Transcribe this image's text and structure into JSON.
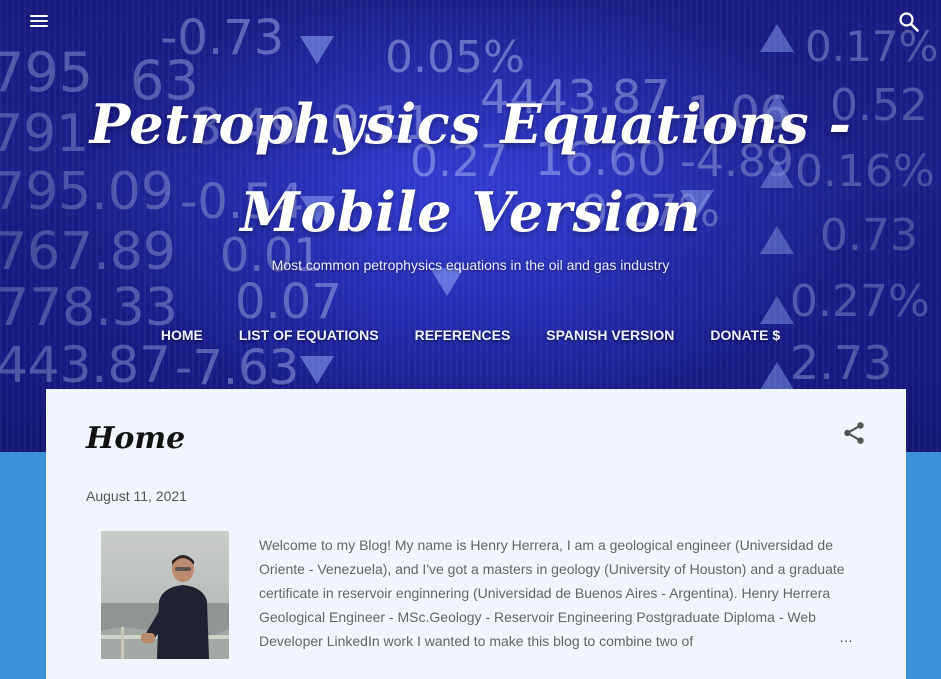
{
  "header": {
    "title": "Petrophysics Equations - Mobile Version",
    "description": "Most common petrophysics equations in the oil and gas industry",
    "menu_icon": "hamburger-menu-icon",
    "search_icon": "search-icon"
  },
  "background_ticker": {
    "numbers": [
      {
        "text": "-0.73"
      },
      {
        "text": "0.05%"
      },
      {
        "text": "0.17%"
      },
      {
        "text": "795"
      },
      {
        "text": "63"
      },
      {
        "text": "8.49"
      },
      {
        "text": "4443.87"
      },
      {
        "text": "-1.06"
      },
      {
        "text": "0.52"
      },
      {
        "text": "791"
      },
      {
        "text": "0.11"
      },
      {
        "text": "16.60"
      },
      {
        "text": "-4.89"
      },
      {
        "text": "0.27"
      },
      {
        "text": "795.09"
      },
      {
        "text": "-0.54"
      },
      {
        "text": "0.27%"
      },
      {
        "text": "0.16%"
      },
      {
        "text": "767.89"
      },
      {
        "text": "0.01"
      },
      {
        "text": "0.73"
      },
      {
        "text": "778.33"
      },
      {
        "text": "0.07"
      },
      {
        "text": "0.27%"
      },
      {
        "text": "443.87"
      },
      {
        "text": "-7.63"
      },
      {
        "text": "2.73"
      }
    ]
  },
  "nav": {
    "items": [
      {
        "label": "HOME"
      },
      {
        "label": "LIST OF EQUATIONS"
      },
      {
        "label": "REFERENCES"
      },
      {
        "label": "SPANISH VERSION"
      },
      {
        "label": "DONATE $"
      }
    ]
  },
  "post": {
    "title": "Home",
    "date": "August 11, 2021",
    "snippet": "Welcome to my Blog! My name is Henry Herrera, I am a geological engineer (Universidad de Oriente - Venezuela), and I've got a masters in geology (University of Houston) and a graduate certificate in reservoir enginnering (Universidad de Buenos Aires - Argentina). Henry Herrera Geological Engineer - MSc.Geology - Reservoir Engineering Postgraduate Diploma - Web Developer LinkedIn work I wanted to make this blog to combine two of",
    "ellipsis": "…",
    "share_icon": "share-icon"
  },
  "colors": {
    "page_background": "#3d8fd6",
    "card_background": "#f0f6fc",
    "header_blue": "#2a2fb8"
  }
}
